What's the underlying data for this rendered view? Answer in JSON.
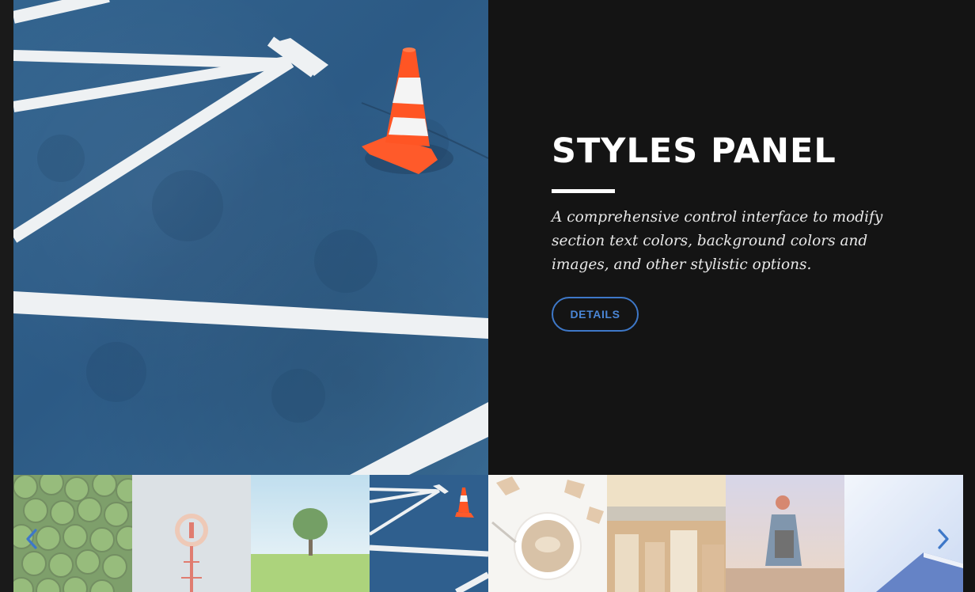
{
  "panel": {
    "title": "STYLES PANEL",
    "description": "A comprehensive control interface to modify section text colors, background colors and images, and other stylistic options.",
    "button_label": "DETAILS"
  },
  "hero": {
    "image": "road-markings-traffic-cone"
  },
  "gallery": {
    "selected_index": 3,
    "thumbnails": [
      {
        "image": "green-grapes"
      },
      {
        "image": "neon-sign-tower"
      },
      {
        "image": "lone-tree-field"
      },
      {
        "image": "road-markings-traffic-cone"
      },
      {
        "image": "coffee-cup-pastries"
      },
      {
        "image": "city-rooftops"
      },
      {
        "image": "woman-backpack-view"
      },
      {
        "image": "blue-building-sky"
      }
    ],
    "prev_icon": "chevron-left-icon",
    "next_icon": "chevron-right-icon"
  },
  "colors": {
    "background": "#141414",
    "accent": "#3e78c8",
    "title": "#ffffff"
  }
}
